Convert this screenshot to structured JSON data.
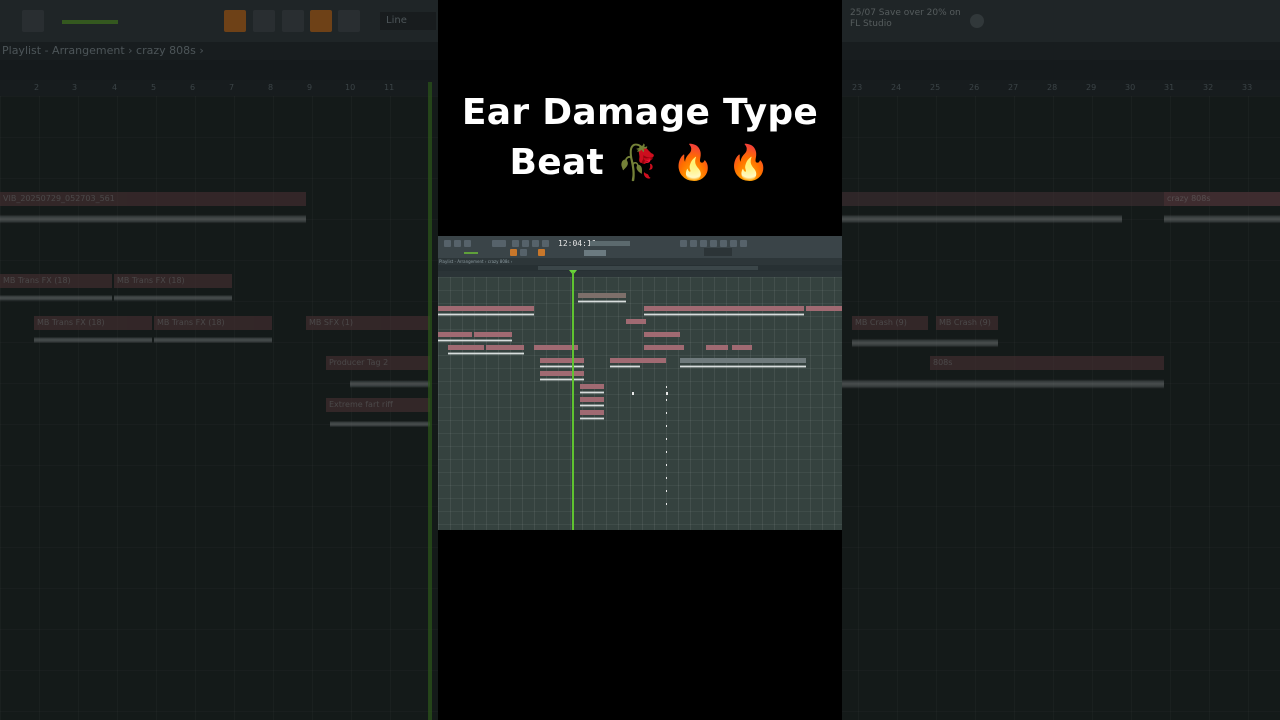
{
  "caption": {
    "line1": "Ear Damage Type",
    "line2_text": "Beat",
    "emojis": [
      "🥀",
      "🔥",
      "🔥"
    ]
  },
  "background_window": {
    "breadcrumb": "Playlist - Arrangement › crazy 808s ›",
    "snap_label": "Line",
    "promo_line1": "25/07  Save over 20% on",
    "promo_line2": "FL Studio",
    "ruler_numbers": [
      "2",
      "3",
      "4",
      "5",
      "6",
      "7",
      "8",
      "9",
      "10",
      "11",
      "23",
      "24",
      "25",
      "26",
      "27",
      "28",
      "29",
      "30",
      "31",
      "32",
      "33"
    ],
    "clips": [
      "VIB_20250729_052703_561",
      "MB Trans FX (18)",
      "MB Trans FX (18)",
      "MB Trans FX (18)",
      "MB Trans FX (18)",
      "MB SFX (1)",
      "Producer Tag 2",
      "Extreme fart riff",
      "crazy 808s",
      "MB Crash (9)",
      "MB Crash (9)",
      "808s"
    ]
  },
  "inner_window": {
    "time": "12:04:11",
    "breadcrumb": "Playlist - Arrangement › crazy 808s ›"
  },
  "colors": {
    "playhead": "#5fc330",
    "accent_orange": "#c8772b",
    "clip_pink": "#a06a72"
  }
}
